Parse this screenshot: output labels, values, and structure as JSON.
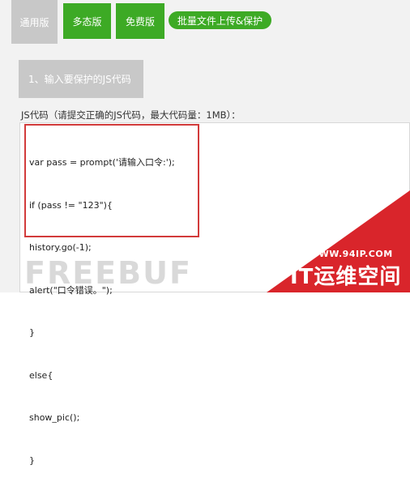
{
  "tabs": [
    {
      "label": "通用版"
    },
    {
      "label": "多态版"
    },
    {
      "label": "免费版"
    },
    {
      "label": "批量文件上传&保护"
    }
  ],
  "step": {
    "label": "1、输入要保护的JS代码"
  },
  "hint": "JS代码（请提交正确的JS代码，最大代码量：1MB）：",
  "code_lines": [
    "var pass = prompt('请输入口令:');",
    "if (pass != \"123\"){",
    "history.go(-1);",
    "alert(\"口令错误。\");",
    "}",
    "else{",
    "show_pic();",
    "}"
  ],
  "watermark": {
    "left": "FREEBUF",
    "url": "WWW.94IP.COM",
    "title": "IT运维空间"
  },
  "colors": {
    "green": "#3daa25",
    "gray": "#c8c8c8",
    "highlight": "#d23b3b",
    "corner": "#d9252b"
  }
}
